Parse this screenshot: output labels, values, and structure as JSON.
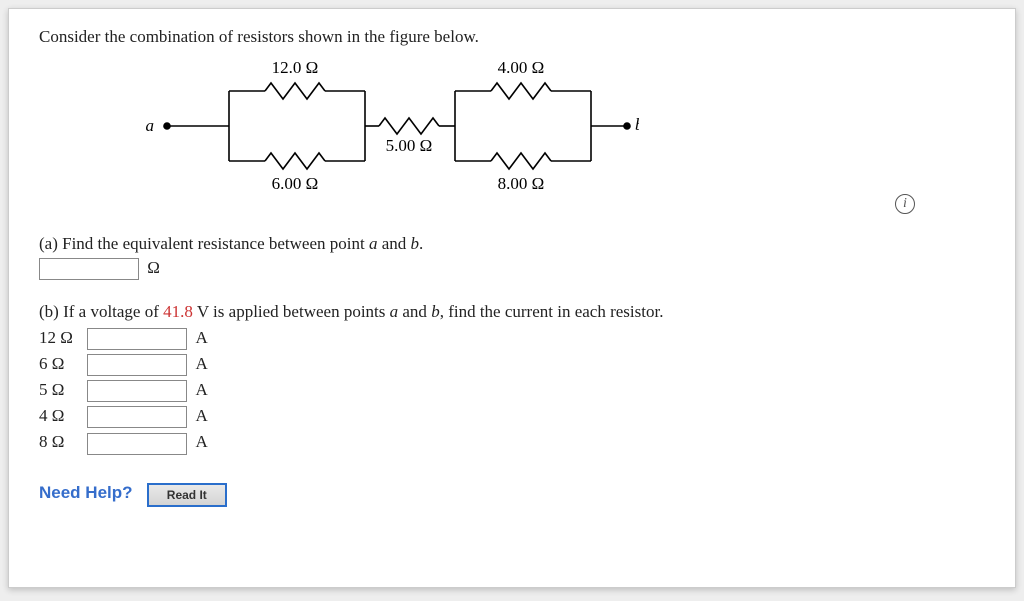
{
  "prompt": "Consider the combination of resistors shown in the figure below.",
  "circuit": {
    "terminal_a": "a",
    "terminal_b": "b",
    "r_top_left": "12.0 Ω",
    "r_bottom_left": "6.00 Ω",
    "r_middle": "5.00 Ω",
    "r_top_right": "4.00 Ω",
    "r_bottom_right": "8.00 Ω"
  },
  "info_icon_glyph": "i",
  "part_a": {
    "text_before": "(a) Find the equivalent resistance between point ",
    "a_var": "a",
    "text_mid": " and ",
    "b_var": "b",
    "text_after": ".",
    "unit": "Ω"
  },
  "part_b": {
    "text_before": "(b) If a voltage of ",
    "voltage": "41.8",
    "text_mid": " V is applied between points ",
    "a_var": "a",
    "text_mid2": " and ",
    "b_var": "b",
    "text_after": ", find the current in each resistor.",
    "rows": [
      {
        "label": "12 Ω",
        "unit": "A"
      },
      {
        "label": "6 Ω",
        "unit": "A"
      },
      {
        "label": "5 Ω",
        "unit": "A"
      },
      {
        "label": "4 Ω",
        "unit": "A"
      },
      {
        "label": "8 Ω",
        "unit": "A"
      }
    ]
  },
  "need_help": {
    "label": "Need Help?",
    "read_it": "Read It"
  }
}
